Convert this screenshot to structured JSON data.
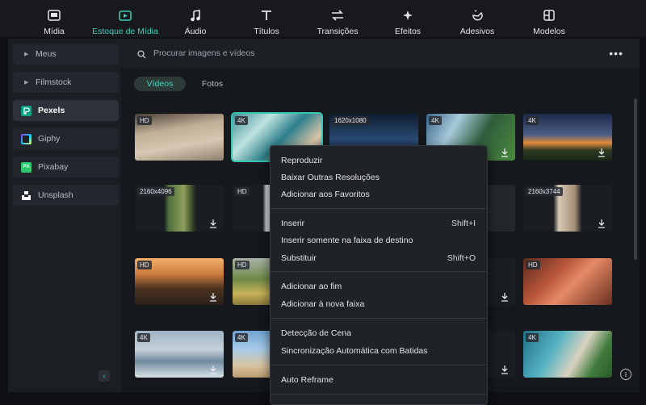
{
  "tabs": [
    {
      "label": "Mídia",
      "icon": "media-icon",
      "active": false
    },
    {
      "label": "Estoque de Mídia",
      "icon": "stock-media-icon",
      "active": true
    },
    {
      "label": "Áudio",
      "icon": "music-note-icon",
      "active": false
    },
    {
      "label": "Títulos",
      "icon": "title-t-icon",
      "active": false
    },
    {
      "label": "Transições",
      "icon": "transition-arrows-icon",
      "active": false
    },
    {
      "label": "Efeitos",
      "icon": "effects-sparkle-icon",
      "active": false
    },
    {
      "label": "Adesivos",
      "icon": "sticker-icon",
      "active": false
    },
    {
      "label": "Modelos",
      "icon": "templates-icon",
      "active": false
    }
  ],
  "sidebar": {
    "items": [
      {
        "label": "Meus",
        "type": "expandable"
      },
      {
        "label": "Filmstock",
        "type": "expandable"
      },
      {
        "label": "Pexels",
        "icon": "pexels-logo-icon",
        "active": true
      },
      {
        "label": "Giphy",
        "icon": "giphy-logo-icon"
      },
      {
        "label": "Pixabay",
        "icon": "pixabay-logo-icon",
        "icon_text": "PX"
      },
      {
        "label": "Unsplash",
        "icon": "unsplash-logo-icon"
      }
    ]
  },
  "search": {
    "placeholder": "Procurar imagens e vídeos"
  },
  "filter_tabs": {
    "videos": "Vídeos",
    "photos": "Fotos"
  },
  "thumbnails": [
    {
      "badge": "HD",
      "download": false
    },
    {
      "badge": "4K",
      "download": false,
      "selected": true
    },
    {
      "badge": "1620x1080",
      "download": false
    },
    {
      "badge": "4K",
      "download": true
    },
    {
      "badge": "4K",
      "download": true
    },
    {
      "badge": "2160x4096",
      "download": true
    },
    {
      "badge": "HD",
      "download": false
    },
    {
      "badge": "",
      "download": false
    },
    {
      "badge": "",
      "download": false
    },
    {
      "badge": "2160x3744",
      "download": true
    },
    {
      "badge": "HD",
      "download": true
    },
    {
      "badge": "HD",
      "download": false
    },
    {
      "badge": "",
      "download": false
    },
    {
      "badge": "",
      "download": true
    },
    {
      "badge": "HD",
      "download": false
    },
    {
      "badge": "4K",
      "download": true
    },
    {
      "badge": "4K",
      "download": false
    },
    {
      "badge": "",
      "download": false
    },
    {
      "badge": "",
      "download": true
    },
    {
      "badge": "4K",
      "download": false
    }
  ],
  "context_menu": {
    "items": [
      {
        "label": "Reproduzir",
        "shortcut": ""
      },
      {
        "label": "Baixar Outras Resoluções",
        "shortcut": ""
      },
      {
        "label": "Adicionar aos Favoritos",
        "shortcut": ""
      },
      {
        "label": "Inserir",
        "shortcut": "Shift+I"
      },
      {
        "label": "Inserir somente na faixa de destino",
        "shortcut": ""
      },
      {
        "label": "Substituir",
        "shortcut": "Shift+O"
      },
      {
        "label": "Adicionar ao fim",
        "shortcut": ""
      },
      {
        "label": "Adicionar à nova faixa",
        "shortcut": ""
      },
      {
        "label": "Detecção de Cena",
        "shortcut": ""
      },
      {
        "label": "Sincronização Automática com Batidas",
        "shortcut": ""
      },
      {
        "label": "Auto Reframe",
        "shortcut": ""
      }
    ]
  },
  "colors": {
    "accent": "#3cd0b9",
    "background": "#0e1013",
    "panel": "#1b1e23"
  }
}
